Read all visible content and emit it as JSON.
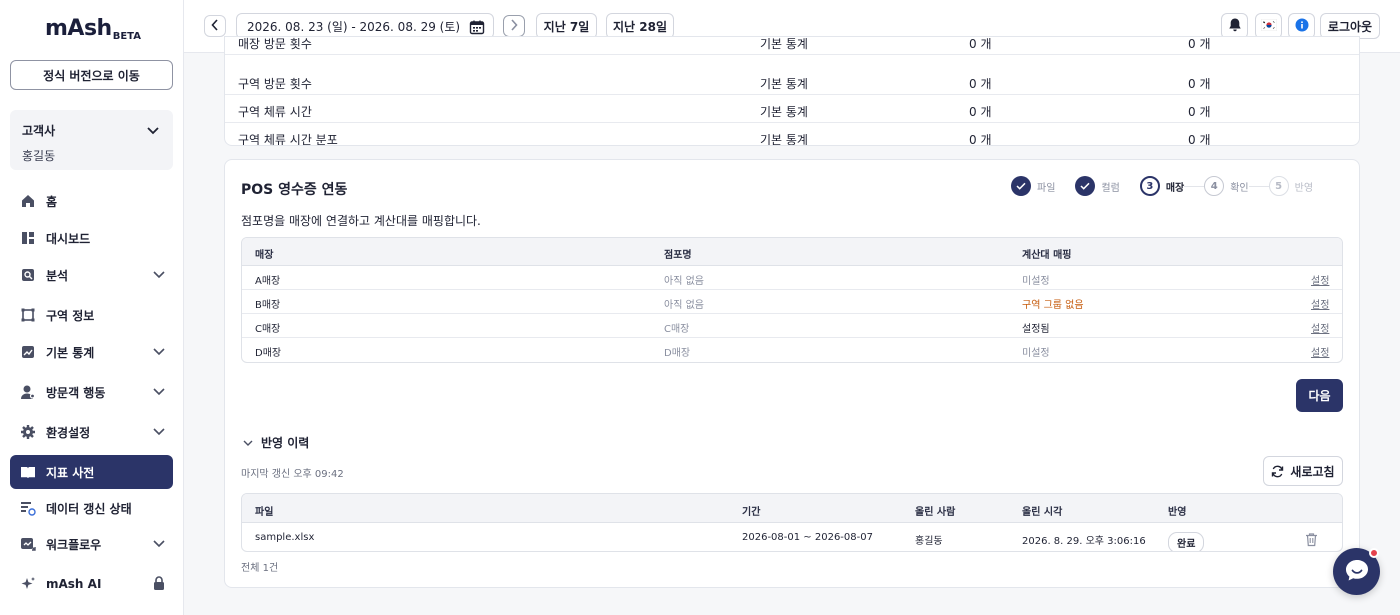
{
  "sidebar": {
    "logo_word": "mAsh",
    "logo_badge": "BETA",
    "official_button": "정식 버전으로 이동",
    "client_label": "고객사",
    "client_name": "홍길동",
    "items": [
      {
        "label": "홈",
        "icon": "home-icon",
        "has_chevron": false
      },
      {
        "label": "대시보드",
        "icon": "dashboard-icon",
        "has_chevron": false
      },
      {
        "label": "분석",
        "icon": "search-icon",
        "has_chevron": true
      },
      {
        "label": "구역 정보",
        "icon": "zone-icon",
        "has_chevron": false
      },
      {
        "label": "기본 통계",
        "icon": "chart-icon",
        "has_chevron": true
      },
      {
        "label": "방문객 행동",
        "icon": "visitor-icon",
        "has_chevron": true
      },
      {
        "label": "환경설정",
        "icon": "gear-icon",
        "has_chevron": true
      },
      {
        "label": "지표 사전",
        "icon": "book-icon",
        "has_chevron": false,
        "active": true
      },
      {
        "label": "데이터 갱신 상태",
        "icon": "sync-list-icon",
        "has_chevron": false
      },
      {
        "label": "워크플로우",
        "icon": "workflow-icon",
        "has_chevron": true
      },
      {
        "label": "mAsh AI",
        "icon": "sparkle-icon",
        "has_chevron": false,
        "locked": true
      }
    ]
  },
  "header": {
    "date_range": "2026. 08. 23 (일) - 2026. 08. 29 (토)",
    "last7": "지난 7일",
    "last28": "지난 28일",
    "logout": "로그아웃"
  },
  "top_table": {
    "rows": [
      {
        "name": "매장 방문 횟수",
        "category": "기본 통계",
        "v1": "0 개",
        "v2": "0 개"
      },
      {
        "name": "구역 방문 횟수",
        "category": "기본 통계",
        "v1": "0 개",
        "v2": "0 개"
      },
      {
        "name": "구역 체류 시간",
        "category": "기본 통계",
        "v1": "0 개",
        "v2": "0 개"
      },
      {
        "name": "구역 체류 시간 분포",
        "category": "기본 통계",
        "v1": "0 개",
        "v2": "0 개"
      }
    ]
  },
  "pos": {
    "title": "POS 영수증 연동",
    "description": "점포명을 매장에 연결하고 계산대를 매핑합니다.",
    "steps": [
      {
        "num": "1",
        "label": "파일",
        "state": "done"
      },
      {
        "num": "2",
        "label": "컬럼",
        "state": "done"
      },
      {
        "num": "3",
        "label": "매장",
        "state": "current"
      },
      {
        "num": "4",
        "label": "확인",
        "state": "todo"
      },
      {
        "num": "5",
        "label": "반영",
        "state": "todo"
      }
    ],
    "mapping": {
      "headers": [
        "매장",
        "점포명",
        "계산대 매핑"
      ],
      "rows": [
        {
          "store": "A매장",
          "branch": "아직 없음",
          "branch_muted": true,
          "mapping": "미설정",
          "mapping_state": "muted",
          "action": "설정"
        },
        {
          "store": "B매장",
          "branch": "아직 없음",
          "branch_muted": true,
          "mapping": "구역 그룹 없음",
          "mapping_state": "warn",
          "action": "설정"
        },
        {
          "store": "C매장",
          "branch": "C매장",
          "branch_muted": true,
          "mapping": "설정됨",
          "mapping_state": "ok",
          "action": "설정"
        },
        {
          "store": "D매장",
          "branch": "D매장",
          "branch_muted": true,
          "mapping": "미설정",
          "mapping_state": "muted",
          "action": "설정"
        }
      ]
    },
    "next_button": "다음",
    "history": {
      "toggle_label": "반영 이력",
      "last_updated": "마지막 갱신 오후 09:42",
      "refresh_button": "새로고침",
      "headers": [
        "파일",
        "기간",
        "올린 사람",
        "올린 시각",
        "반영"
      ],
      "rows": [
        {
          "file": "sample.xlsx",
          "period": "2026-08-01 ~ 2026-08-07",
          "uploader": "홍길동",
          "uploaded_at": "2026. 8. 29. 오후 3:06:16",
          "status": "완료"
        }
      ],
      "total": "전체 1건"
    }
  },
  "colors": {
    "brand": "#2b3468",
    "warn": "#c55a0b",
    "notification_dot": "#e5424d"
  }
}
